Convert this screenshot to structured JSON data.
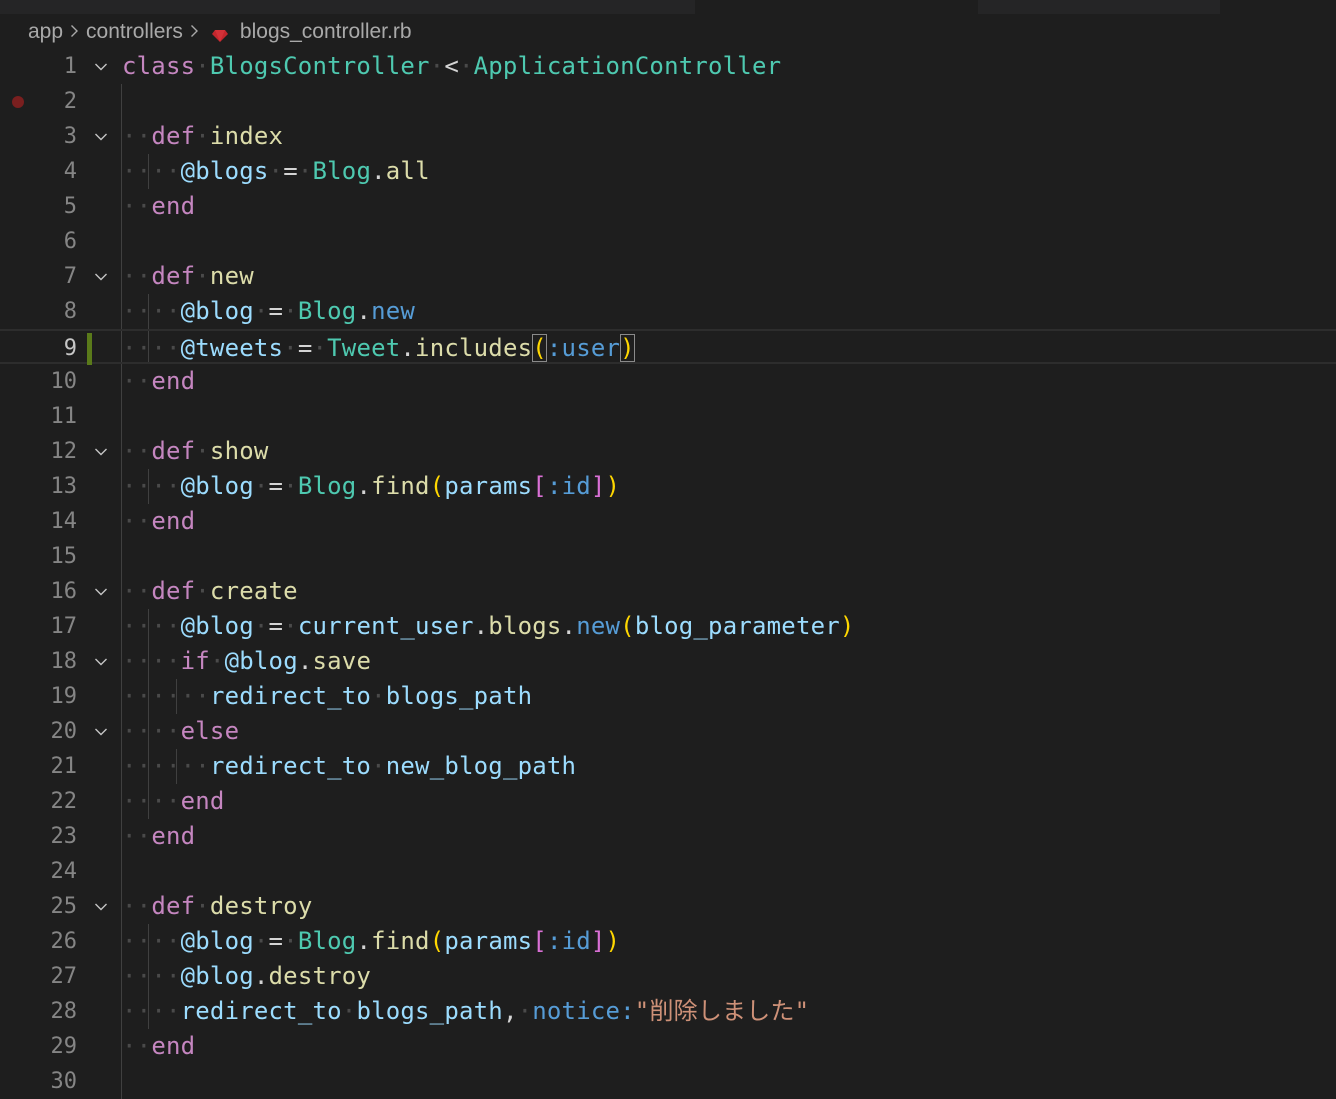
{
  "breadcrumb": {
    "items": [
      "app",
      "controllers",
      "blogs_controller.rb"
    ],
    "separator": ">",
    "file_icon": "ruby-icon"
  },
  "editor": {
    "current_line": 9,
    "breakpoint_line": 2,
    "modified_line": 9,
    "folded_lines": [
      1,
      3,
      7,
      12,
      16,
      18,
      20,
      25
    ],
    "colors": {
      "background": "#1e1e1e",
      "keyword": "#c586c0",
      "class": "#4ec9b0",
      "function": "#dcdcaa",
      "variable": "#9cdcfe",
      "symbol": "#569cd6",
      "string": "#ce9178",
      "bracket": "#ffd700",
      "breakpoint": "#7a1f1f",
      "git_modified": "#5a7a1a"
    },
    "lines": [
      {
        "n": "1",
        "i": 0,
        "t": [
          [
            "kw",
            "class"
          ],
          [
            "ws",
            "·"
          ],
          [
            "cls",
            "BlogsController"
          ],
          [
            "ws",
            "·"
          ],
          [
            "op",
            "<"
          ],
          [
            "ws",
            "·"
          ],
          [
            "cls",
            "ApplicationController"
          ]
        ]
      },
      {
        "n": "2",
        "i": 0,
        "t": []
      },
      {
        "n": "3",
        "i": 1,
        "t": [
          [
            "kw",
            "def"
          ],
          [
            "ws",
            "·"
          ],
          [
            "fn",
            "index"
          ]
        ]
      },
      {
        "n": "4",
        "i": 2,
        "t": [
          [
            "ivar",
            "@blogs"
          ],
          [
            "ws",
            "·"
          ],
          [
            "op",
            "="
          ],
          [
            "ws",
            "·"
          ],
          [
            "cls",
            "Blog"
          ],
          [
            "op",
            "."
          ],
          [
            "fn",
            "all"
          ]
        ]
      },
      {
        "n": "5",
        "i": 1,
        "t": [
          [
            "kw",
            "end"
          ]
        ]
      },
      {
        "n": "6",
        "i": 0,
        "t": []
      },
      {
        "n": "7",
        "i": 1,
        "t": [
          [
            "kw",
            "def"
          ],
          [
            "ws",
            "·"
          ],
          [
            "fn",
            "new"
          ]
        ]
      },
      {
        "n": "8",
        "i": 2,
        "t": [
          [
            "ivar",
            "@blog"
          ],
          [
            "ws",
            "·"
          ],
          [
            "op",
            "="
          ],
          [
            "ws",
            "·"
          ],
          [
            "cls",
            "Blog"
          ],
          [
            "op",
            "."
          ],
          [
            "sym",
            "new"
          ]
        ]
      },
      {
        "n": "9",
        "i": 2,
        "t": [
          [
            "ivar",
            "@tweets"
          ],
          [
            "ws",
            "·"
          ],
          [
            "op",
            "="
          ],
          [
            "ws",
            "·"
          ],
          [
            "cls",
            "Tweet"
          ],
          [
            "op",
            "."
          ],
          [
            "fn",
            "includes"
          ],
          [
            "br1 bm",
            "("
          ],
          [
            "sym",
            ":user"
          ],
          [
            "br1 bm",
            ")"
          ]
        ]
      },
      {
        "n": "10",
        "i": 1,
        "t": [
          [
            "kw",
            "end"
          ]
        ]
      },
      {
        "n": "11",
        "i": 0,
        "t": []
      },
      {
        "n": "12",
        "i": 1,
        "t": [
          [
            "kw",
            "def"
          ],
          [
            "ws",
            "·"
          ],
          [
            "fn",
            "show"
          ]
        ]
      },
      {
        "n": "13",
        "i": 2,
        "t": [
          [
            "ivar",
            "@blog"
          ],
          [
            "ws",
            "·"
          ],
          [
            "op",
            "="
          ],
          [
            "ws",
            "·"
          ],
          [
            "cls",
            "Blog"
          ],
          [
            "op",
            "."
          ],
          [
            "fn",
            "find"
          ],
          [
            "br1",
            "("
          ],
          [
            "ident",
            "params"
          ],
          [
            "br2",
            "["
          ],
          [
            "sym",
            ":id"
          ],
          [
            "br2",
            "]"
          ],
          [
            "br1",
            ")"
          ]
        ]
      },
      {
        "n": "14",
        "i": 1,
        "t": [
          [
            "kw",
            "end"
          ]
        ]
      },
      {
        "n": "15",
        "i": 0,
        "t": []
      },
      {
        "n": "16",
        "i": 1,
        "t": [
          [
            "kw",
            "def"
          ],
          [
            "ws",
            "·"
          ],
          [
            "fn",
            "create"
          ]
        ]
      },
      {
        "n": "17",
        "i": 2,
        "t": [
          [
            "ivar",
            "@blog"
          ],
          [
            "ws",
            "·"
          ],
          [
            "op",
            "="
          ],
          [
            "ws",
            "·"
          ],
          [
            "ident",
            "current_user"
          ],
          [
            "op",
            "."
          ],
          [
            "fn",
            "blogs"
          ],
          [
            "op",
            "."
          ],
          [
            "sym",
            "new"
          ],
          [
            "br1",
            "("
          ],
          [
            "ident",
            "blog_parameter"
          ],
          [
            "br1",
            ")"
          ]
        ]
      },
      {
        "n": "18",
        "i": 2,
        "t": [
          [
            "kw",
            "if"
          ],
          [
            "ws",
            "·"
          ],
          [
            "ivar",
            "@blog"
          ],
          [
            "op",
            "."
          ],
          [
            "fn",
            "save"
          ]
        ]
      },
      {
        "n": "19",
        "i": 3,
        "t": [
          [
            "ident",
            "redirect_to"
          ],
          [
            "ws",
            "·"
          ],
          [
            "ident",
            "blogs_path"
          ]
        ]
      },
      {
        "n": "20",
        "i": 2,
        "t": [
          [
            "kw",
            "else"
          ]
        ]
      },
      {
        "n": "21",
        "i": 3,
        "t": [
          [
            "ident",
            "redirect_to"
          ],
          [
            "ws",
            "·"
          ],
          [
            "ident",
            "new_blog_path"
          ]
        ]
      },
      {
        "n": "22",
        "i": 2,
        "t": [
          [
            "kw",
            "end"
          ]
        ]
      },
      {
        "n": "23",
        "i": 1,
        "t": [
          [
            "kw",
            "end"
          ]
        ]
      },
      {
        "n": "24",
        "i": 0,
        "t": []
      },
      {
        "n": "25",
        "i": 1,
        "t": [
          [
            "kw",
            "def"
          ],
          [
            "ws",
            "·"
          ],
          [
            "fn",
            "destroy"
          ]
        ]
      },
      {
        "n": "26",
        "i": 2,
        "t": [
          [
            "ivar",
            "@blog"
          ],
          [
            "ws",
            "·"
          ],
          [
            "op",
            "="
          ],
          [
            "ws",
            "·"
          ],
          [
            "cls",
            "Blog"
          ],
          [
            "op",
            "."
          ],
          [
            "fn",
            "find"
          ],
          [
            "br1",
            "("
          ],
          [
            "ident",
            "params"
          ],
          [
            "br2",
            "["
          ],
          [
            "sym",
            ":id"
          ],
          [
            "br2",
            "]"
          ],
          [
            "br1",
            ")"
          ]
        ]
      },
      {
        "n": "27",
        "i": 2,
        "t": [
          [
            "ivar",
            "@blog"
          ],
          [
            "op",
            "."
          ],
          [
            "fn",
            "destroy"
          ]
        ]
      },
      {
        "n": "28",
        "i": 2,
        "t": [
          [
            "ident",
            "redirect_to"
          ],
          [
            "ws",
            "·"
          ],
          [
            "ident",
            "blogs_path"
          ],
          [
            "op",
            ","
          ],
          [
            "ws",
            "·"
          ],
          [
            "sym",
            "notice:"
          ],
          [
            "str",
            "\"削除しました\""
          ]
        ]
      },
      {
        "n": "29",
        "i": 1,
        "t": [
          [
            "kw",
            "end"
          ]
        ]
      },
      {
        "n": "30",
        "i": 0,
        "t": []
      }
    ]
  }
}
